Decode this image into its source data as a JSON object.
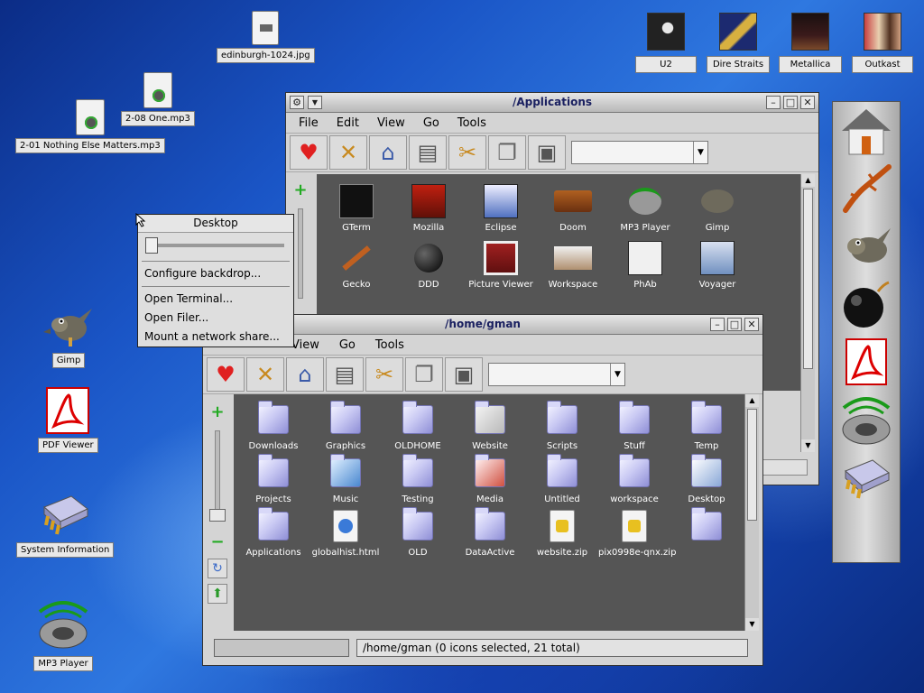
{
  "desktop": {
    "icons": [
      {
        "label": "edinburgh-1024.jpg"
      },
      {
        "label": "2-08 One.mp3"
      },
      {
        "label": "2-01 Nothing Else Matters.mp3"
      },
      {
        "label": "Gimp"
      },
      {
        "label": "PDF Viewer"
      },
      {
        "label": "System Information"
      },
      {
        "label": "MP3 Player"
      }
    ],
    "albums": [
      {
        "label": "U2"
      },
      {
        "label": "Dire Straits"
      },
      {
        "label": "Metallica"
      },
      {
        "label": "Outkast"
      }
    ]
  },
  "context_menu": {
    "title": "Desktop",
    "items": [
      {
        "label": "Configure backdrop..."
      },
      {
        "label": "Open Terminal..."
      },
      {
        "label": "Open Filer..."
      },
      {
        "label": "Mount a network share..."
      }
    ]
  },
  "applications_window": {
    "title": "/Applications",
    "menu": [
      "File",
      "Edit",
      "View",
      "Go",
      "Tools"
    ],
    "files": [
      "GTerm",
      "Mozilla",
      "Eclipse",
      "Doom",
      "MP3 Player",
      "Gimp",
      "Gecko",
      "DDD",
      "Picture Viewer",
      "Workspace",
      "PhAb",
      "Voyager"
    ]
  },
  "home_window": {
    "title": "/home/gman",
    "menu": [
      "View",
      "Go",
      "Tools"
    ],
    "files": [
      "Downloads",
      "Graphics",
      "OLDHOME",
      "Website",
      "Scripts",
      "Stuff",
      "Temp",
      "Projects",
      "Music",
      "Testing",
      "Media",
      "Untitled",
      "workspace",
      "Desktop",
      "Applications",
      "globalhist.html",
      "OLD",
      "DataActive",
      "website.zip",
      "pix0998e-qnx.zip"
    ],
    "status": "/home/gman (0 icons selected, 21 total)"
  },
  "icons": {
    "window": [
      "gear-icon",
      "down-arrow-icon",
      "minimize-icon",
      "maximize-icon",
      "close-icon"
    ],
    "toolbar": [
      "favorites-heart-icon",
      "cancel-x-icon",
      "home-icon",
      "computer-icon",
      "cut-scissors-icon",
      "copy-icon",
      "paste-clipboard-icon"
    ],
    "dock": [
      "home-icon",
      "gecko-icon",
      "gimp-icon",
      "bomb-icon",
      "pdf-icon",
      "speaker-icon",
      "chip-icon"
    ]
  },
  "colors": {
    "desktop_blue": "#1a55c6",
    "file_area": "#555555",
    "window_gray": "#d4d4d4",
    "title_text": "#1a2060",
    "heart_red": "#e02020"
  }
}
